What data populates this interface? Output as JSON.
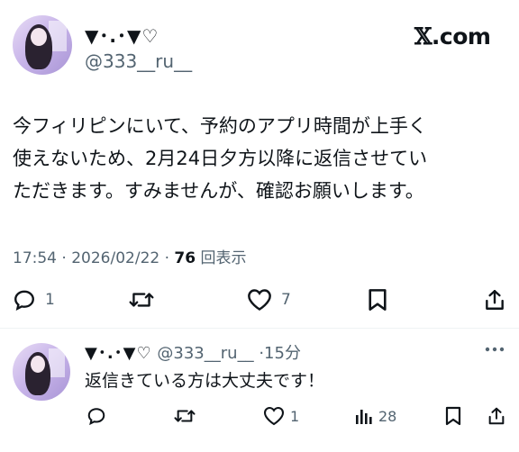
{
  "tweet": {
    "display_name": "▼･.･▼♡",
    "handle": "@333__ru__",
    "site_logo_text": ".com",
    "text_lines": [
      "今フィリピンにいて、予約のアプリ時間が上手く",
      "使えないため、2月24日夕方以降に返信させてい",
      "ただきます。すみませんが、確認お願いします。"
    ],
    "time": "17:54",
    "date": "2026/02/22",
    "views_count": "76",
    "views_label": "回表示",
    "reply_count": "1",
    "retweet_count": "",
    "like_count": "7"
  },
  "reply": {
    "display_name": "▼･.･▼♡",
    "handle": "@333__ru__",
    "time_ago": "15分",
    "text": "返信きている方は大丈夫です！",
    "reply_count": "",
    "retweet_count": "",
    "like_count": "1",
    "views_count": "28"
  },
  "icons": {
    "reply": "speech-bubble-icon",
    "retweet": "retweet-arrows-icon",
    "like": "heart-icon",
    "bookmark": "bookmark-icon",
    "share": "share-upload-icon",
    "views": "bar-chart-icon",
    "more": "more-dots-icon"
  },
  "colors": {
    "text": "#0f1419",
    "secondary": "#536471",
    "divider": "#eff3f4"
  }
}
